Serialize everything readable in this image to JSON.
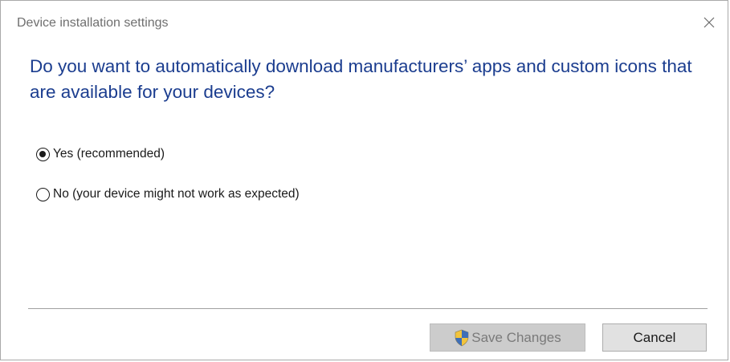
{
  "window": {
    "title": "Device installation settings",
    "close_icon": "close-icon"
  },
  "question": "Do you want to automatically download manufacturers’ apps and custom icons that are available for your devices?",
  "options": [
    {
      "label": "Yes (recommended)",
      "selected": true
    },
    {
      "label": "No (your device might not work as expected)",
      "selected": false
    }
  ],
  "buttons": {
    "save_label": "Save Changes",
    "save_enabled": false,
    "save_icon": "uac-shield-icon",
    "cancel_label": "Cancel"
  },
  "colors": {
    "heading": "#1b3d8f",
    "title": "#6f6f6f"
  }
}
